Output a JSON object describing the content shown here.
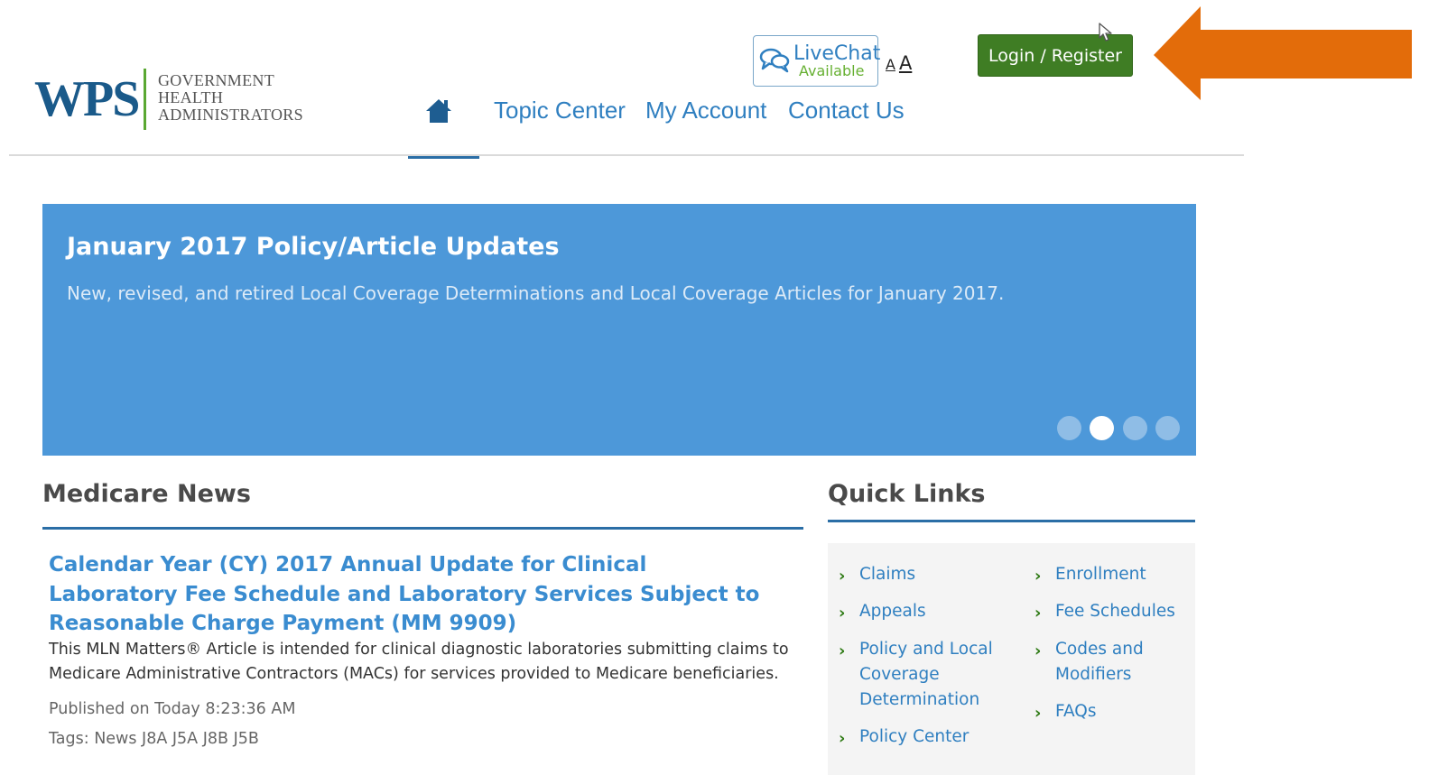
{
  "header": {
    "logo": {
      "brand": "WPS",
      "line1": "GOVERNMENT",
      "line2": "HEALTH",
      "line3": "ADMINISTRATORS"
    },
    "livechat": {
      "title": "LiveChat",
      "status": "Available"
    },
    "font_size": {
      "small": "A",
      "large": "A"
    },
    "login_label": "Login / Register",
    "nav": {
      "home_icon": "home-icon",
      "items": [
        "Topic Center",
        "My Account",
        "Contact Us"
      ]
    }
  },
  "banner": {
    "title": "January 2017 Policy/Article Updates",
    "description": "New, revised, and retired Local Coverage Determinations and Local Coverage Articles for January 2017.",
    "slides": 4,
    "active_slide": 2
  },
  "news": {
    "heading": "Medicare News",
    "article": {
      "title": "Calendar Year (CY) 2017 Annual Update for Clinical Laboratory Fee Schedule and Laboratory Services Subject to Reasonable Charge Payment (MM 9909)",
      "body": "This MLN Matters® Article is intended for clinical diagnostic laboratories submitting claims to Medicare Administrative Contractors (MACs) for services provided to Medicare beneficiaries.",
      "published": "Published on Today 8:23:36 AM",
      "tags": "Tags: News J8A J5A J8B J5B"
    }
  },
  "quick_links": {
    "heading": "Quick Links",
    "left": [
      "Claims",
      "Appeals",
      "Policy and Local Coverage Determination",
      "Policy Center"
    ],
    "right": [
      "Enrollment",
      "Fee Schedules",
      "Codes and Modifiers",
      "FAQs"
    ]
  },
  "colors": {
    "brand_blue": "#2b6ea6",
    "link_blue": "#2f7fc0",
    "banner_blue": "#4d98d9",
    "login_green": "#3f7d24",
    "callout_orange": "#e36c0a"
  },
  "icons": {
    "chat": "chat-bubbles-icon",
    "home": "home-icon",
    "chevron": "chevron-right-icon",
    "cursor": "mouse-cursor-icon",
    "arrow": "orange-arrow-icon"
  }
}
